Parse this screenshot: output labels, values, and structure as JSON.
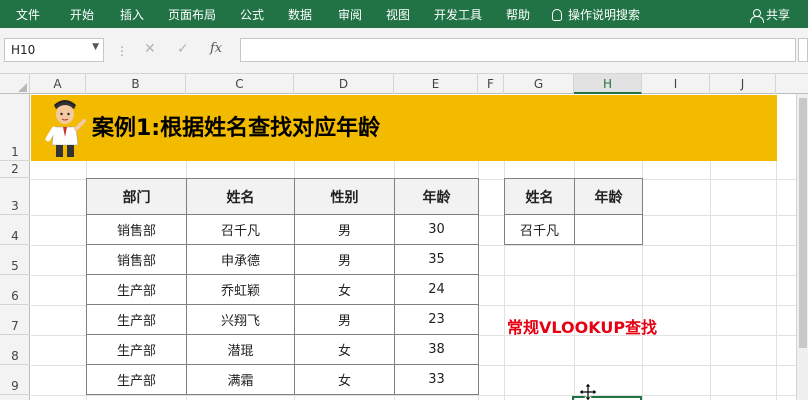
{
  "ribbon": {
    "tabs": [
      "文件",
      "开始",
      "插入",
      "页面布局",
      "公式",
      "数据",
      "审阅",
      "视图",
      "开发工具",
      "帮助"
    ],
    "tell_me": "操作说明搜索",
    "share": "共享",
    "bg_color": "#217346"
  },
  "formula_bar": {
    "name_box": "H10",
    "fx_label": "fx",
    "formula": ""
  },
  "columns": [
    "A",
    "B",
    "C",
    "D",
    "E",
    "F",
    "G",
    "H",
    "I",
    "J"
  ],
  "selected_column": "H",
  "rows": [
    "1",
    "2",
    "3",
    "4",
    "5",
    "6",
    "7",
    "8",
    "9"
  ],
  "banner": {
    "title": "案例1:根据姓名查找对应年龄",
    "color": "#f2bb00"
  },
  "main_table": {
    "headers": [
      "部门",
      "姓名",
      "性别",
      "年龄"
    ],
    "rows": [
      [
        "销售部",
        "召千凡",
        "男",
        "30"
      ],
      [
        "销售部",
        "申承德",
        "男",
        "35"
      ],
      [
        "生产部",
        "乔虹颖",
        "女",
        "24"
      ],
      [
        "生产部",
        "兴翔飞",
        "男",
        "23"
      ],
      [
        "生产部",
        "潜琨",
        "女",
        "38"
      ],
      [
        "生产部",
        "满霜",
        "女",
        "33"
      ]
    ]
  },
  "lookup_table": {
    "headers": [
      "姓名",
      "年龄"
    ],
    "row": [
      "召千凡",
      ""
    ]
  },
  "annotation": {
    "text": "常规VLOOKUP查找",
    "color": "#e60012"
  }
}
